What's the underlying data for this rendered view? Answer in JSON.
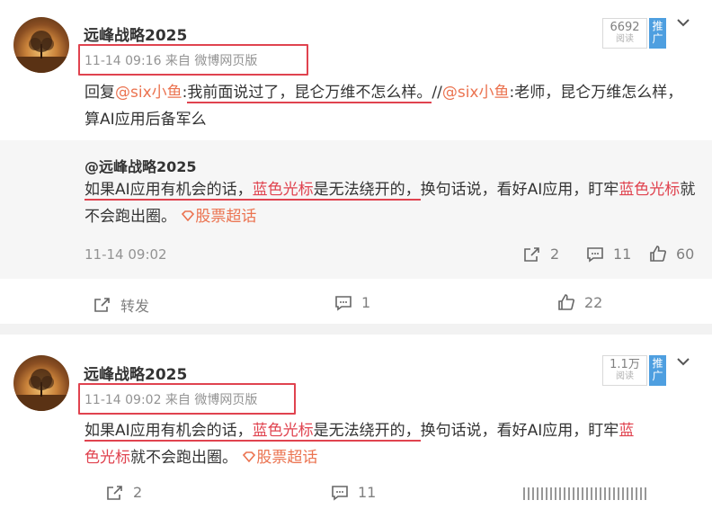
{
  "post1": {
    "author": "远峰战略2025",
    "meta": "11-14 09:16 来自 微博网页版",
    "reads": "6692",
    "reads_label": "阅读",
    "promote_label": "推广",
    "text_prefix": "回复",
    "mention": "@six小鱼",
    "colon1": ":",
    "reply": "我前面说过了，昆仑万维不怎么样。",
    "slashes": "//",
    "mention2": "@six小鱼",
    "quote": ":老师，昆仑万维怎么样，算AI应用后备军么",
    "repost": {
      "author": "@远峰战略2025",
      "t1": "如果AI应用有机会的话，",
      "t2": "蓝色光标",
      "t3": "是无法绕开的，",
      "t4": "换句话说，看好AI应用，盯牢",
      "t5": "蓝色光标",
      "t6": "就不会跑出圈。",
      "topic": "股票超话",
      "time": "11-14 09:02",
      "shares": "2",
      "comments": "11",
      "likes": "60"
    },
    "actions": {
      "forward": "转发",
      "comments": "1",
      "likes": "22"
    }
  },
  "post2": {
    "author": "远峰战略2025",
    "meta": "11-14 09:02 来自 微博网页版",
    "reads": "1.1万",
    "reads_label": "阅读",
    "promote_label": "推广",
    "t1": "如果AI应用有机会的话，",
    "t2": "蓝色光标",
    "t3": "是无法绕开的，",
    "t4": "换句话说，看好AI应用，盯牢",
    "t5a": "蓝",
    "t5b": "色光标",
    "t6": "就不会跑出圈。",
    "topic": "股票超话",
    "shares": "2",
    "comments": "11"
  },
  "colors": {
    "accent": "#eb7350",
    "highlight": "#e0434f",
    "promo": "#4e9fe0"
  }
}
